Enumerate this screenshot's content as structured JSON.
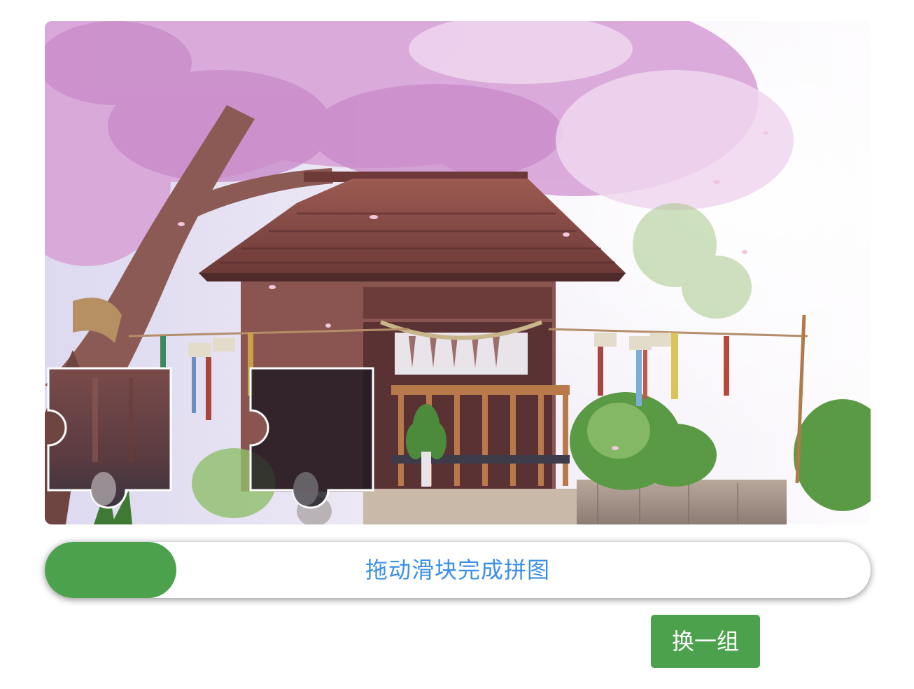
{
  "captcha": {
    "background_image": "cherry-blossom-shrine-illustration",
    "slider_hint": "拖动滑块完成拼图",
    "refresh_label": "换一组",
    "colors": {
      "accent": "#4ca24c",
      "hint_text": "#3b8fe8",
      "track_background": "#ffffff"
    }
  }
}
